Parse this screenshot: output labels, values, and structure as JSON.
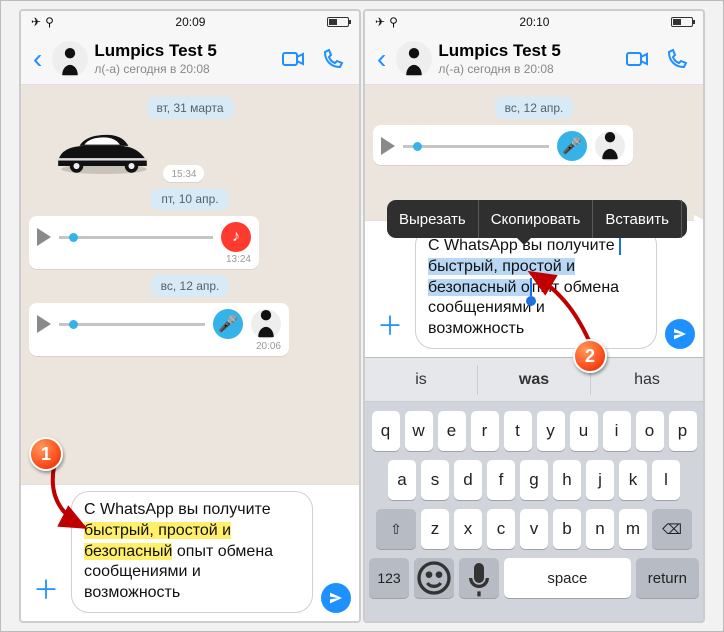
{
  "left": {
    "status": {
      "time": "20:09"
    },
    "header": {
      "name": "Lumpics Test 5",
      "sub": "л(-а) сегодня в 20:08"
    },
    "dates": {
      "d1": "вт, 31 марта",
      "d2": "пт, 10 апр.",
      "d3": "вс, 12 апр."
    },
    "times": {
      "t_sticker": "15:34",
      "t_voice1": "13:24",
      "t_voice2": "20:06"
    },
    "input": {
      "pre": "С WhatsApp вы получите ",
      "hl": "быстрый, простой и безопасный",
      "post": " опыт обмена сообщениями и возможность"
    }
  },
  "right": {
    "status": {
      "time": "20:10"
    },
    "header": {
      "name": "Lumpics Test 5",
      "sub": "л(-а) сегодня в 20:08"
    },
    "dates": {
      "d1": "вс, 12 апр."
    },
    "ctx": {
      "cut": "Вырезать",
      "copy": "Скопировать",
      "paste": "Вставить"
    },
    "input": {
      "pre": "С WhatsApp вы получите ",
      "sel": "быстрый, простой и безопасный о",
      "post": "пыт обмена сообщениями и возможность"
    },
    "suggest": {
      "s1": "is",
      "s2": "was",
      "s3": "has"
    },
    "keys": {
      "num": "123",
      "space": "space",
      "ret": "return",
      "r1": [
        "q",
        "w",
        "e",
        "r",
        "t",
        "y",
        "u",
        "i",
        "o",
        "p"
      ],
      "r2": [
        "a",
        "s",
        "d",
        "f",
        "g",
        "h",
        "j",
        "k",
        "l"
      ],
      "r3": [
        "z",
        "x",
        "c",
        "v",
        "b",
        "n",
        "m"
      ]
    }
  },
  "markers": {
    "m1": "1",
    "m2": "2"
  }
}
